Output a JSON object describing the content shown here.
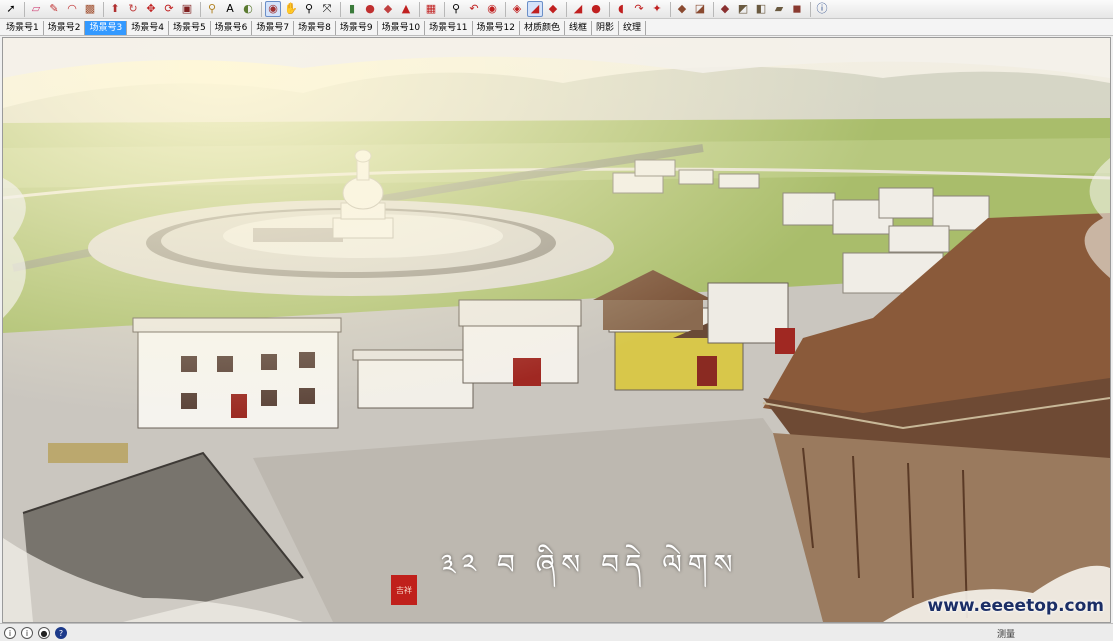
{
  "toolbar": {
    "icons": [
      "select-icon",
      "eraser-icon",
      "pencil-icon",
      "arc-icon",
      "rectangle-icon",
      "push-pull-icon",
      "follow-me-icon",
      "move-icon",
      "rotate-icon",
      "scale-icon",
      "tape-measure-icon",
      "text-icon",
      "paint-bucket-icon",
      "orbit-icon",
      "pan-icon",
      "zoom-icon",
      "zoom-extents-icon",
      "components-icon",
      "model-info-icon",
      "materials-icon",
      "styles-icon",
      "shadows-icon",
      "walk-icon",
      "look-around-icon",
      "position-camera-icon",
      "section-plane-icon",
      "xray-icon",
      "back-edges-icon",
      "wireframe-icon",
      "hidden-line-icon",
      "shaded-icon",
      "textured-icon",
      "monochrome-icon",
      "iso-view-icon",
      "top-view-icon",
      "front-view-icon",
      "right-view-icon",
      "back-view-icon",
      "left-view-icon",
      "help-icon"
    ]
  },
  "scene_tabs": [
    {
      "label": "场景号1"
    },
    {
      "label": "场景号2"
    },
    {
      "label": "场景号3",
      "active": true
    },
    {
      "label": "场景号4"
    },
    {
      "label": "场景号5"
    },
    {
      "label": "场景号6"
    },
    {
      "label": "场景号7"
    },
    {
      "label": "场景号8"
    },
    {
      "label": "场景号9"
    },
    {
      "label": "场景号10"
    },
    {
      "label": "场景号11"
    },
    {
      "label": "场景号12"
    },
    {
      "label": "材质颜色"
    },
    {
      "label": "线框"
    },
    {
      "label": "阴影"
    },
    {
      "label": "纹理"
    }
  ],
  "viewport": {
    "caption_tibetan": "༣༢ བ ཞིས བདེ ལེགས",
    "seal_text": "吉祥",
    "watermark": "www.eeeetop.com"
  },
  "statusbar": {
    "icons": [
      "info-icon",
      "credit-icon",
      "user-icon",
      "help-icon"
    ],
    "measure_label": "测量"
  },
  "colors": {
    "selected_tab": "#3399ff",
    "grass": "#9bb65a",
    "roof": "#8a5a3a",
    "ground": "#c9c6c0"
  }
}
